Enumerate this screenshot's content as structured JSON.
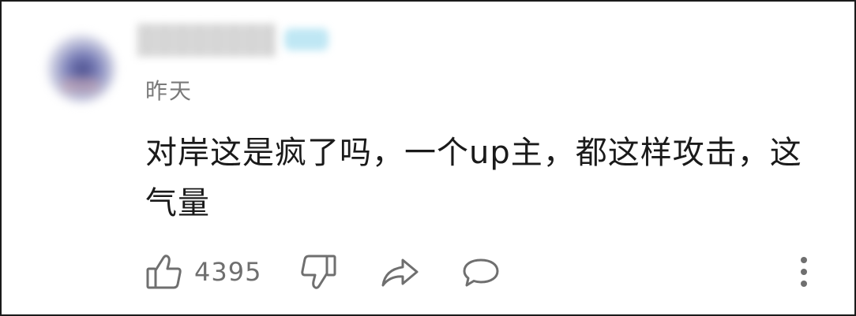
{
  "comment": {
    "author": {
      "name": "",
      "badge": ""
    },
    "timestamp": "昨天",
    "text": "对岸这是疯了吗，一个up主，都这样攻击，这气量"
  },
  "actions": {
    "like_count": "4395"
  },
  "icons": {
    "like": "thumbs-up-icon",
    "dislike": "thumbs-down-icon",
    "share": "share-icon",
    "reply": "reply-icon",
    "more": "more-vertical-icon"
  }
}
